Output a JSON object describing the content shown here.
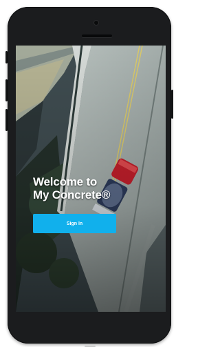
{
  "welcome": {
    "line1": "Welcome to",
    "line2": "My Concrete®"
  },
  "sign_in": {
    "label": "Sign In"
  },
  "colors": {
    "accent": "#11b0ec",
    "device": "#1b1c1e",
    "background": "#ffffff"
  }
}
